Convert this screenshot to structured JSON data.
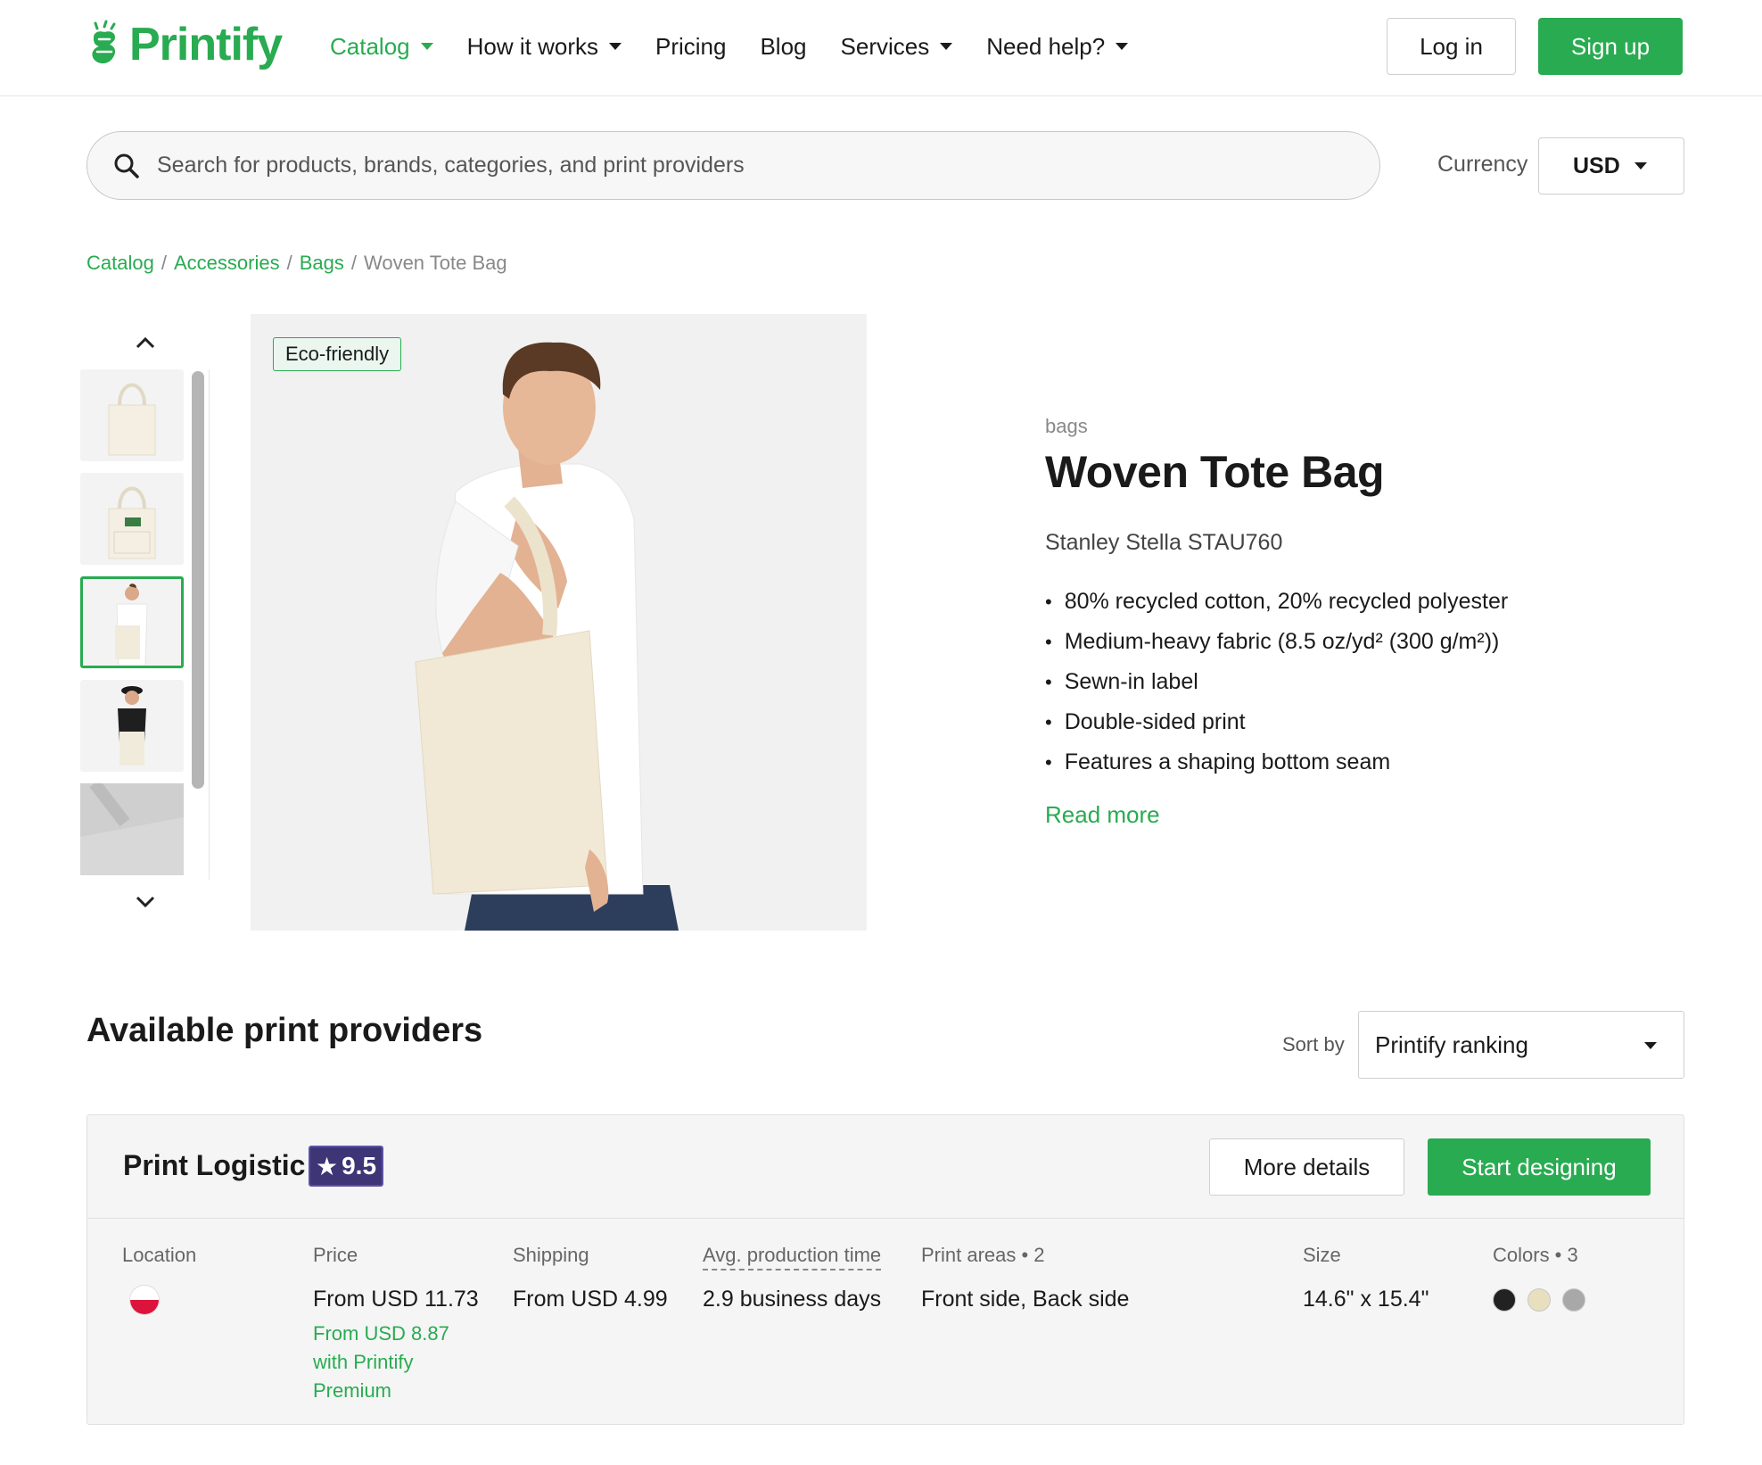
{
  "brand": {
    "name": "Printify",
    "color": "#29ab51"
  },
  "nav": [
    {
      "label": "Catalog",
      "dropdown": true,
      "active": true
    },
    {
      "label": "How it works",
      "dropdown": true
    },
    {
      "label": "Pricing",
      "dropdown": false
    },
    {
      "label": "Blog",
      "dropdown": false
    },
    {
      "label": "Services",
      "dropdown": true
    },
    {
      "label": "Need help?",
      "dropdown": true
    }
  ],
  "auth": {
    "login": "Log in",
    "signup": "Sign up"
  },
  "search": {
    "placeholder": "Search for products, brands, categories, and print providers",
    "icon": "search-icon"
  },
  "currency": {
    "label": "Currency",
    "value": "USD"
  },
  "breadcrumb": {
    "items": [
      "Catalog",
      "Accessories",
      "Bags"
    ],
    "current": "Woven Tote Bag"
  },
  "gallery": {
    "badge": "Eco-friendly",
    "thumbnails": [
      "tote-bag-plain",
      "tote-bag-with-design",
      "man-carrying-tote",
      "woman-carrying-tote",
      "tote-bag-fabric-closeup"
    ],
    "selected_index": 2
  },
  "product": {
    "category": "bags",
    "title": "Woven Tote Bag",
    "model": "Stanley Stella STAU760",
    "features": [
      "80% recycled cotton, 20% recycled polyester",
      "Medium-heavy fabric (8.5 oz/yd² (300 g/m²))",
      "Sewn-in label",
      "Double-sided print",
      "Features a shaping bottom seam"
    ],
    "read_more": "Read more"
  },
  "providers": {
    "title": "Available print providers",
    "sort": {
      "label": "Sort by",
      "value": "Printify ranking"
    },
    "items": [
      {
        "name": "Print Logistic",
        "rating": "9.5",
        "more_details": "More details",
        "start_designing": "Start designing",
        "location": {
          "label": "Location",
          "flag": "poland-flag"
        },
        "price": {
          "label": "Price",
          "value": "From USD 11.73",
          "premium": "From USD 8.87 with Printify Premium"
        },
        "shipping": {
          "label": "Shipping",
          "value": "From USD 4.99"
        },
        "production": {
          "label": "Avg. production time",
          "value": "2.9 business days"
        },
        "print_areas": {
          "label": "Print areas • 2",
          "value": "Front side, Back side"
        },
        "size": {
          "label": "Size",
          "value": "14.6\" x 15.4\""
        },
        "colors": {
          "label": "Colors • 3",
          "swatches": [
            "#222222",
            "#e8dfbf",
            "#a8a8a8"
          ]
        }
      }
    ]
  }
}
